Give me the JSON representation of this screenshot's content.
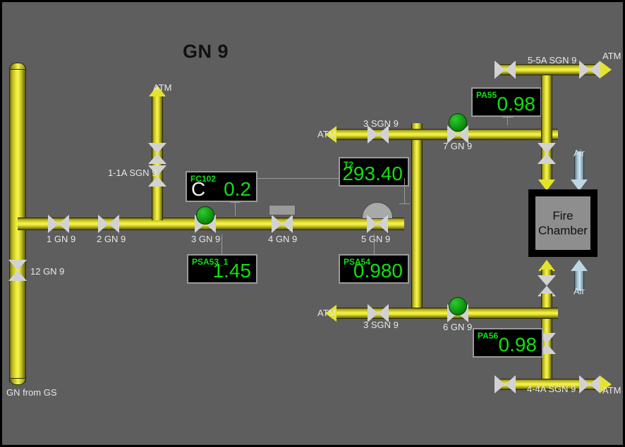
{
  "screen": {
    "title": "GN 9",
    "background_color": "#5e5e5e",
    "pipe_color": "#e9e82e",
    "air_color": "#bcd7e3",
    "valve_open_color": "#10a010"
  },
  "source_label": "GN from GS",
  "fire_chamber": {
    "line1": "Fire",
    "line2": "Chamber"
  },
  "vents": {
    "atm_top_left": "ATM",
    "atm_mid_left": "ATM",
    "atm_bottom_left": "ATM",
    "atm_top_right": "ATM",
    "atm_bottom_right": "ATM"
  },
  "air_labels": {
    "top": "Air",
    "bottom": "Air"
  },
  "valves": [
    {
      "id": "v1",
      "label": "1 GN 9",
      "orientation": "horizontal",
      "actuator": "none"
    },
    {
      "id": "v2",
      "label": "2 GN 9",
      "orientation": "horizontal",
      "actuator": "none"
    },
    {
      "id": "v3",
      "label": "3 GN 9",
      "orientation": "horizontal",
      "actuator": "circle-green"
    },
    {
      "id": "v4",
      "label": "4 GN 9",
      "orientation": "horizontal",
      "actuator": "rect"
    },
    {
      "id": "v5",
      "label": "5 GN 9",
      "orientation": "horizontal",
      "actuator": "dome"
    },
    {
      "id": "v6",
      "label": "6 GN 9",
      "orientation": "horizontal",
      "actuator": "circle-green"
    },
    {
      "id": "v7",
      "label": "7 GN 9",
      "orientation": "horizontal",
      "actuator": "circle-green"
    },
    {
      "id": "v12",
      "label": "12 GN 9",
      "orientation": "vertical",
      "actuator": "none"
    },
    {
      "id": "v11a",
      "label": "1-1A SGN 9",
      "orientation": "vertical",
      "actuator": "none"
    },
    {
      "id": "v3sgn_top",
      "label": "3 SGN 9",
      "orientation": "horizontal",
      "actuator": "none"
    },
    {
      "id": "v3sgn_bottom",
      "label": "3 SGN 9",
      "orientation": "horizontal",
      "actuator": "none"
    },
    {
      "id": "v55a",
      "label": "5-5A SGN 9",
      "orientation": "horizontal",
      "actuator": "none"
    },
    {
      "id": "v44a",
      "label": "4-4A SGN 9",
      "orientation": "horizontal",
      "actuator": "none"
    }
  ],
  "instruments": [
    {
      "id": "fc102",
      "tag": "FC102",
      "unit": "C",
      "value": "0.2"
    },
    {
      "id": "psa53_1",
      "tag": "PSA53_1",
      "unit": "",
      "value": "1.45"
    },
    {
      "id": "t2",
      "tag": "T2",
      "unit": "",
      "value": "293.40"
    },
    {
      "id": "psa54",
      "tag": "PSA54",
      "unit": "",
      "value": "0.980"
    },
    {
      "id": "pa55",
      "tag": "PA55",
      "unit": "",
      "value": "0.98"
    },
    {
      "id": "pa56",
      "tag": "PA56",
      "unit": "",
      "value": "0.98"
    }
  ]
}
